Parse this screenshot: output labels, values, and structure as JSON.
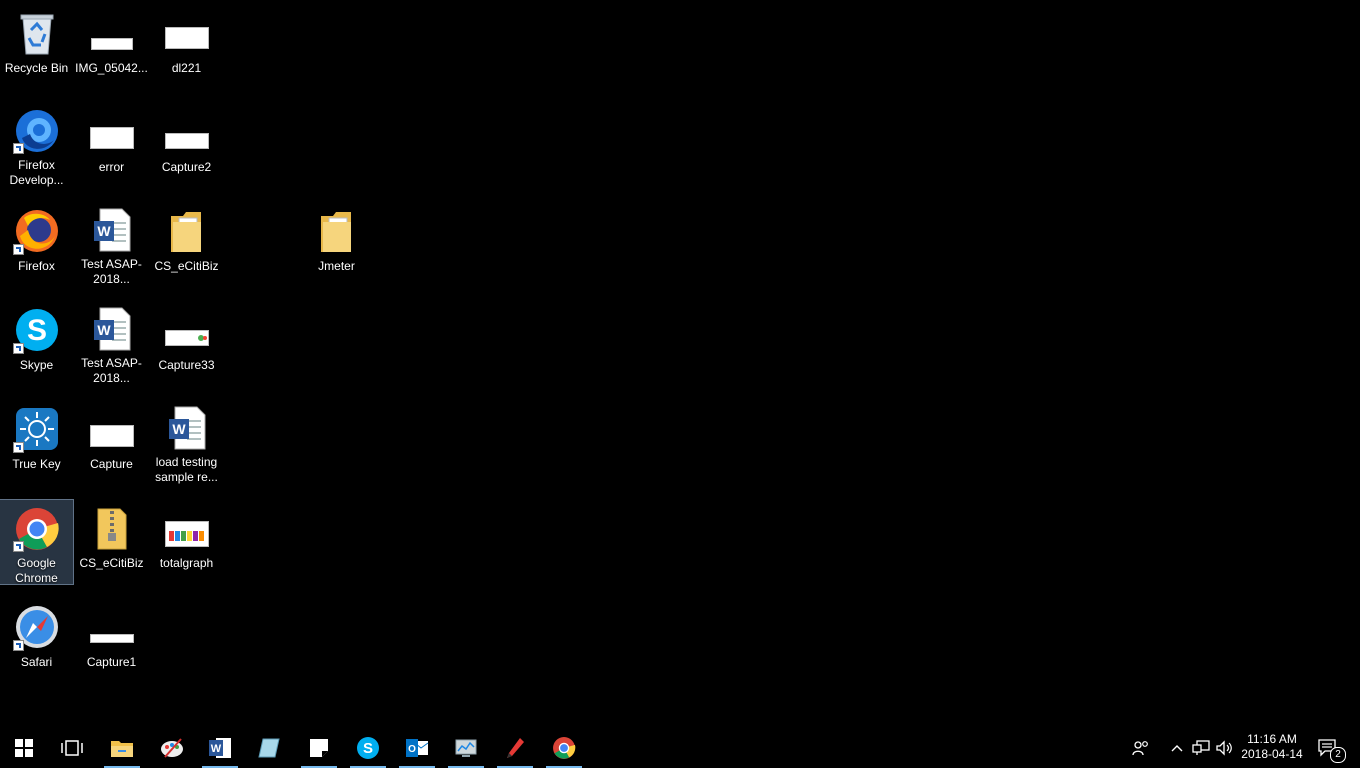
{
  "desktop": {
    "icons": [
      {
        "label": "Recycle Bin",
        "icon": "recycle-bin-icon"
      },
      {
        "label": "Firefox Develop...",
        "icon": "firefox-developer-icon"
      },
      {
        "label": "Firefox",
        "icon": "firefox-icon"
      },
      {
        "label": "Skype",
        "icon": "skype-icon"
      },
      {
        "label": "True Key",
        "icon": "true-key-icon"
      },
      {
        "label": "Google Chrome",
        "icon": "chrome-icon"
      },
      {
        "label": "Safari",
        "icon": "safari-icon"
      },
      {
        "label": "IMG_05042...",
        "icon": "image-file-icon"
      },
      {
        "label": "error",
        "icon": "image-file-icon"
      },
      {
        "label": "Test ASAP-2018...",
        "icon": "word-document-icon"
      },
      {
        "label": "Test ASAP-2018...",
        "icon": "word-document-icon"
      },
      {
        "label": "Capture",
        "icon": "image-file-icon"
      },
      {
        "label": "CS_eCitiBiz",
        "icon": "zip-folder-icon"
      },
      {
        "label": "Capture1",
        "icon": "image-file-icon"
      },
      {
        "label": "dl221",
        "icon": "image-file-icon"
      },
      {
        "label": "Capture2",
        "icon": "image-file-icon"
      },
      {
        "label": "CS_eCitiBiz",
        "icon": "folder-icon"
      },
      {
        "label": "Capture33",
        "icon": "image-file-icon"
      },
      {
        "label": "load testing sample re...",
        "icon": "word-document-icon"
      },
      {
        "label": "totalgraph",
        "icon": "image-file-icon"
      },
      {
        "label": "Jmeter",
        "icon": "folder-icon"
      }
    ],
    "selected": "Google Chrome"
  },
  "taskbar": {
    "apps": [
      {
        "name": "start",
        "icon": "windows-start-icon"
      },
      {
        "name": "task-view",
        "icon": "task-view-icon"
      },
      {
        "name": "file-explorer",
        "icon": "file-explorer-icon"
      },
      {
        "name": "paint",
        "icon": "paint-icon"
      },
      {
        "name": "word",
        "icon": "word-icon"
      },
      {
        "name": "notepad-like",
        "icon": "app-icon"
      },
      {
        "name": "sticky-notes",
        "icon": "sticky-notes-icon"
      },
      {
        "name": "skype",
        "icon": "skype-icon"
      },
      {
        "name": "outlook",
        "icon": "outlook-icon"
      },
      {
        "name": "system-app",
        "icon": "monitor-icon"
      },
      {
        "name": "pen-app",
        "icon": "pen-icon"
      },
      {
        "name": "chrome",
        "icon": "chrome-icon"
      }
    ],
    "tray": {
      "clock_time": "11:16 AM",
      "clock_date": "2018-04-14",
      "notification_count": "2"
    }
  },
  "colors": {
    "accent": "#76b9ed",
    "background": "#000000"
  }
}
